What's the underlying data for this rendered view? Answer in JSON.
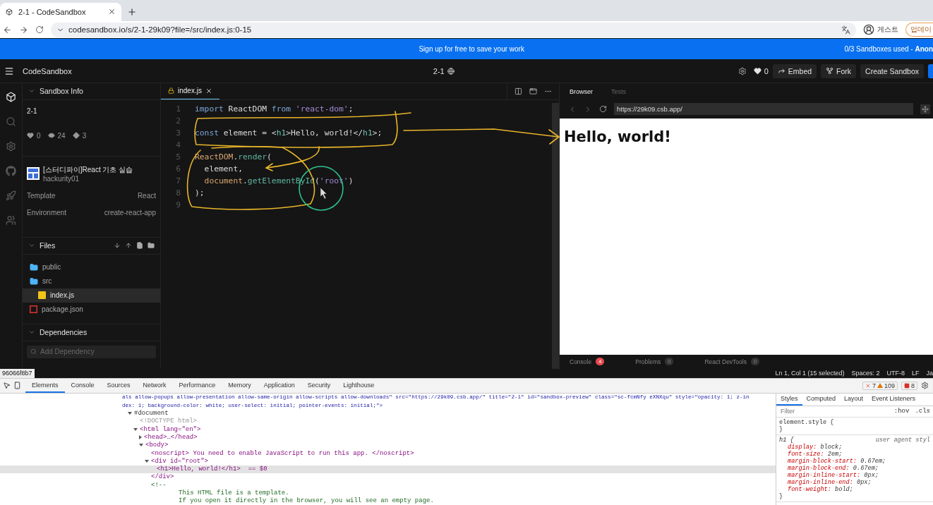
{
  "browser_tab": {
    "title": "2-1 - CodeSandbox"
  },
  "address_bar": {
    "url": "codesandbox.io/s/2-1-29k09?file=/src/index.js:0-15",
    "profile": "게스트",
    "update_button": "업데이"
  },
  "banner": {
    "message": "Sign up for free to save your work",
    "usage": "0/3 Sandboxes used - **Anon**"
  },
  "header": {
    "brand": "CodeSandbox",
    "sandbox_name": "2-1",
    "likes": "0",
    "buttons": [
      {
        "label": "Embed",
        "kind": "embed"
      },
      {
        "label": "Fork",
        "kind": "fork"
      },
      {
        "label": "Create Sandbox",
        "kind": "plain"
      }
    ]
  },
  "activity_bar": [
    {
      "kind": "cube",
      "selected": true
    },
    {
      "kind": "search",
      "selected": false
    },
    {
      "kind": "settings",
      "selected": false
    },
    {
      "kind": "github",
      "selected": false
    },
    {
      "kind": "rocket",
      "selected": false
    },
    {
      "kind": "users",
      "selected": false
    }
  ],
  "sidebar": {
    "sandbox_info": {
      "title": "Sandbox Info",
      "expanded": true,
      "name": "2-1",
      "stats": [
        {
          "kind": "likes",
          "value": "0"
        },
        {
          "kind": "views",
          "value": "24"
        },
        {
          "kind": "forks",
          "value": "3"
        }
      ],
      "team": "[스터디파이]React 기초 실습",
      "owner": "hackurity01",
      "details": [
        {
          "label": "Template",
          "value": "React"
        },
        {
          "label": "Environment",
          "value": "create-react-app"
        }
      ]
    },
    "files": {
      "title": "Files",
      "expanded": true,
      "items": [
        {
          "name": "public",
          "kind": "folder",
          "selected": false
        },
        {
          "name": "src",
          "kind": "folder",
          "selected": false,
          "children": [
            {
              "name": "index.js",
              "kind": "js",
              "selected": true
            }
          ]
        },
        {
          "name": "package.json",
          "kind": "json",
          "selected": false
        }
      ]
    },
    "dependencies": {
      "title": "Dependencies",
      "expanded": true,
      "placeholder": "Add Dependency"
    }
  },
  "editor": {
    "tabs": [
      {
        "label": "index.js",
        "selected": true
      }
    ],
    "lines": [
      {
        "number": "1",
        "tokens": [
          {
            "text": "import",
            "kind": "keyword"
          },
          {
            "text": " ReactDOM ",
            "kind": "plain"
          },
          {
            "text": "from",
            "kind": "keyword"
          },
          {
            "text": " 'react-dom'",
            "kind": "string"
          },
          {
            "text": ";",
            "kind": "plain"
          }
        ]
      },
      {
        "number": "2"
      },
      {
        "number": "3",
        "tokens": [
          {
            "text": "const",
            "kind": "keyword"
          },
          {
            "text": " element = <",
            "kind": "plain"
          },
          {
            "text": "h1",
            "kind": "tag"
          },
          {
            "text": ">Hello, world!</",
            "kind": "plain"
          },
          {
            "text": "h1",
            "kind": "tag"
          },
          {
            "text": ">;",
            "kind": "plain"
          }
        ]
      },
      {
        "number": "4"
      },
      {
        "number": "5",
        "tokens": [
          {
            "text": "ReactDOM",
            "kind": "object"
          },
          {
            "text": ".",
            "kind": "plain"
          },
          {
            "text": "render",
            "kind": "method"
          },
          {
            "text": "(",
            "kind": "plain"
          }
        ]
      },
      {
        "number": "6",
        "tokens": [
          {
            "text": "  element,",
            "kind": "plain"
          }
        ]
      },
      {
        "number": "7",
        "tokens": [
          {
            "text": "  document",
            "kind": "object"
          },
          {
            "text": ".",
            "kind": "plain"
          },
          {
            "text": "getElementById",
            "kind": "method"
          },
          {
            "text": "(",
            "kind": "plain"
          },
          {
            "text": "'root'",
            "kind": "string"
          },
          {
            "text": ")",
            "kind": "plain"
          }
        ]
      },
      {
        "number": "8",
        "tokens": [
          {
            "text": ");",
            "kind": "plain"
          }
        ]
      },
      {
        "number": "9"
      }
    ]
  },
  "preview": {
    "tabs": [
      {
        "label": "Browser",
        "selected": true
      },
      {
        "label": "Tests",
        "selected": false
      }
    ],
    "url": "https://29k09.csb.app/",
    "heading": "Hello, world!",
    "bottom_tabs": [
      {
        "label": "Console",
        "count": "4",
        "alert": true
      },
      {
        "label": "Problems",
        "count": "0",
        "alert": false
      },
      {
        "label": "React DevTools",
        "count": "0",
        "alert": false
      }
    ]
  },
  "status_bar": {
    "commit": "96066f8b7",
    "items": [
      "Ln 1, Col 1 (15 selected)",
      "Spaces: 2",
      "UTF-8",
      "LF",
      "Ja"
    ]
  },
  "devtools": {
    "tabs": [
      {
        "label": "Elements",
        "selected": true
      },
      {
        "label": "Console",
        "selected": false
      },
      {
        "label": "Sources",
        "selected": false
      },
      {
        "label": "Network",
        "selected": false
      },
      {
        "label": "Performance",
        "selected": false
      },
      {
        "label": "Memory",
        "selected": false
      },
      {
        "label": "Application",
        "selected": false
      },
      {
        "label": "Security",
        "selected": false
      },
      {
        "label": "Lighthouse",
        "selected": false
      }
    ],
    "errors": "7",
    "warnings": "109",
    "issues": "8",
    "wrapped": [
      "als allow-popups allow-presentation allow-same-origin allow-scripts allow-downloads\" src=\"https://29k09.csb.app/\" title=\"2-1\" id=\"sandbox-preview\" class=\"sc-fcmNfy eXNXqu\" style=\"opacity: 1; z-in",
      "dex: 1; background-color: white; user-select: initial; pointer-events: initial;\">"
    ],
    "tree": [
      {
        "kind": "document",
        "text": "#document",
        "expanded": true,
        "selected": false,
        "children": [
          {
            "kind": "doctype",
            "text": "<!DOCTYPE html>",
            "selected": false
          },
          {
            "kind": "element",
            "text": "<html lang=\"en\">",
            "expanded": true,
            "selected": false,
            "children": [
              {
                "kind": "element",
                "text": "<head>…</head>",
                "expanded": false,
                "selected": false
              },
              {
                "kind": "element",
                "text": "<body>",
                "expanded": true,
                "selected": false,
                "children": [
                  {
                    "kind": "element",
                    "text": "<noscript> You need to enable JavaScript to run this app. </noscript>",
                    "selected": false
                  },
                  {
                    "kind": "element",
                    "text": "<div id=\"root\">",
                    "expanded": true,
                    "selected": false,
                    "closing": "</div>",
                    "children": [
                      {
                        "kind": "element",
                        "text": "<h1>Hello, world!</h1>",
                        "suffix": "== $0",
                        "selected": true
                      }
                    ]
                  },
                  {
                    "kind": "comment",
                    "text": "<!--",
                    "selected": false,
                    "lines": [
                      "This HTML file is a template.",
                      "If you open it directly in the browser, you will see an empty page."
                    ]
                  }
                ]
              }
            ]
          }
        ]
      }
    ],
    "styles": {
      "tabs": [
        {
          "label": "Styles",
          "selected": true
        },
        {
          "label": "Computed",
          "selected": false
        },
        {
          "label": "Layout",
          "selected": false
        },
        {
          "label": "Event Listeners",
          "selected": false
        }
      ],
      "filter_placeholder": "Filter",
      "toggles": [
        ":hov",
        ".cls"
      ],
      "rules": [
        {
          "selector": "element.style {",
          "close": "}"
        },
        {
          "selector": "h1 {",
          "origin": "user agent styl",
          "declarations": [
            {
              "property": "display:",
              "value": "block;"
            },
            {
              "property": "font-size:",
              "value": "2em;"
            },
            {
              "property": "margin-block-start:",
              "value": "0.67em;"
            },
            {
              "property": "margin-block-end:",
              "value": "0.67em;"
            },
            {
              "property": "margin-inline-start:",
              "value": "0px;"
            },
            {
              "property": "margin-inline-end:",
              "value": "0px;"
            },
            {
              "property": "font-weight:",
              "value": "bold;"
            }
          ],
          "close": "}"
        }
      ]
    }
  }
}
